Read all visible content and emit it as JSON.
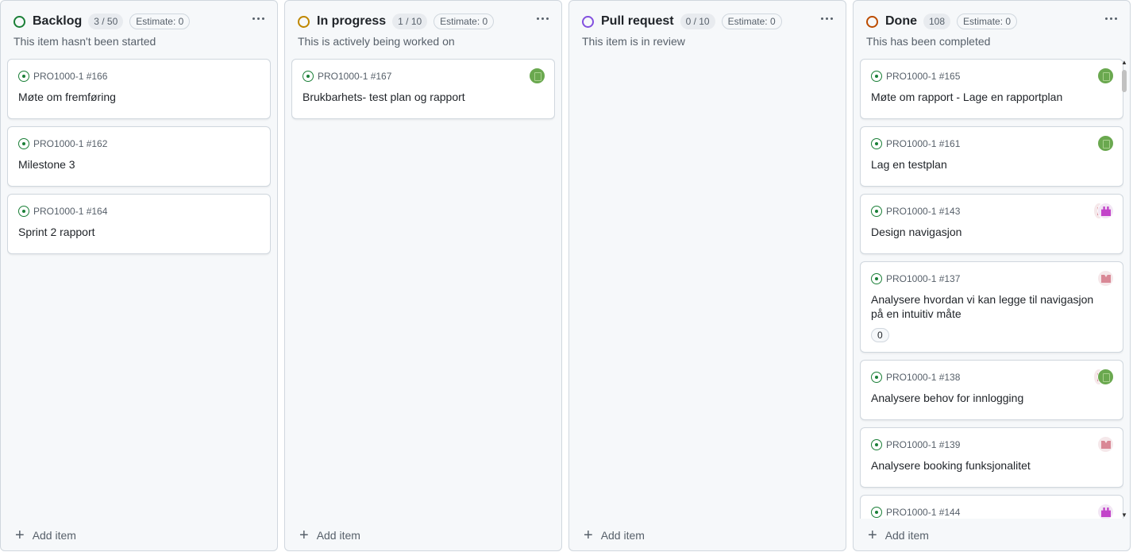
{
  "columns": [
    {
      "title": "Backlog",
      "count": "3 / 50",
      "estimate": "Estimate: 0",
      "description": "This item hasn't been started",
      "status_color": "#1a7f37",
      "add_item": "Add item",
      "cards": [
        {
          "ref": "PRO1000-1 #166",
          "title": "Møte om fremføring",
          "avatars": []
        },
        {
          "ref": "PRO1000-1 #162",
          "title": "Milestone 3",
          "avatars": []
        },
        {
          "ref": "PRO1000-1 #164",
          "title": "Sprint 2 rapport",
          "avatars": []
        }
      ]
    },
    {
      "title": "In progress",
      "count": "1 / 10",
      "estimate": "Estimate: 0",
      "description": "This is actively being worked on",
      "status_color": "#bf8700",
      "add_item": "Add item",
      "cards": [
        {
          "ref": "PRO1000-1 #167",
          "title": "Brukbarhets- test plan og rapport",
          "avatars": [
            "green"
          ]
        }
      ]
    },
    {
      "title": "Pull request",
      "count": "0 / 10",
      "estimate": "Estimate: 0",
      "description": "This item is in review",
      "status_color": "#8250df",
      "add_item": "Add item",
      "cards": []
    },
    {
      "title": "Done",
      "count": "108",
      "estimate": "Estimate: 0",
      "description": "This has been completed",
      "status_color": "#bc4c00",
      "add_item": "Add item",
      "cards": [
        {
          "ref": "PRO1000-1 #165",
          "title": "Møte om rapport - Lage en rapportplan",
          "avatars": [
            "green"
          ]
        },
        {
          "ref": "PRO1000-1 #161",
          "title": "Lag en testplan",
          "avatars": [
            "green"
          ]
        },
        {
          "ref": "PRO1000-1 #143",
          "title": "Design navigasjon",
          "avatars": [
            "rose",
            "pink"
          ]
        },
        {
          "ref": "PRO1000-1 #137",
          "title": "Analysere hvordan vi kan legge til navigasjon på en intuitiv måte",
          "count": "0",
          "avatars": [
            "rose"
          ]
        },
        {
          "ref": "PRO1000-1 #138",
          "title": "Analysere behov for innlogging",
          "avatars": [
            "rose",
            "green"
          ]
        },
        {
          "ref": "PRO1000-1 #139",
          "title": "Analysere booking funksjonalitet",
          "avatars": [
            "rose"
          ]
        },
        {
          "ref": "PRO1000-1 #144",
          "title": "",
          "avatars": [
            "pink"
          ]
        }
      ]
    }
  ]
}
